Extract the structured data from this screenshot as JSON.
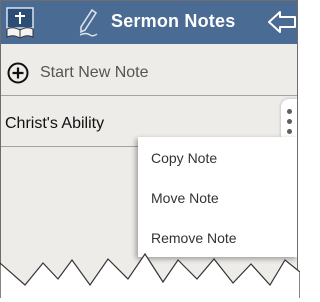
{
  "header": {
    "title": "Sermon Notes",
    "color": "#496b94"
  },
  "actions": {
    "new_note_label": "Start New Note"
  },
  "notes": [
    {
      "title": "Christ's Ability"
    }
  ],
  "context_menu": {
    "items": [
      {
        "label": "Copy Note"
      },
      {
        "label": "Move Note"
      },
      {
        "label": "Remove Note"
      }
    ]
  },
  "icons": {
    "app": "bible-app-icon",
    "edit": "pencil-icon",
    "back": "back-arrow-icon",
    "add": "plus-circle-icon",
    "more": "more-vertical-icon"
  }
}
